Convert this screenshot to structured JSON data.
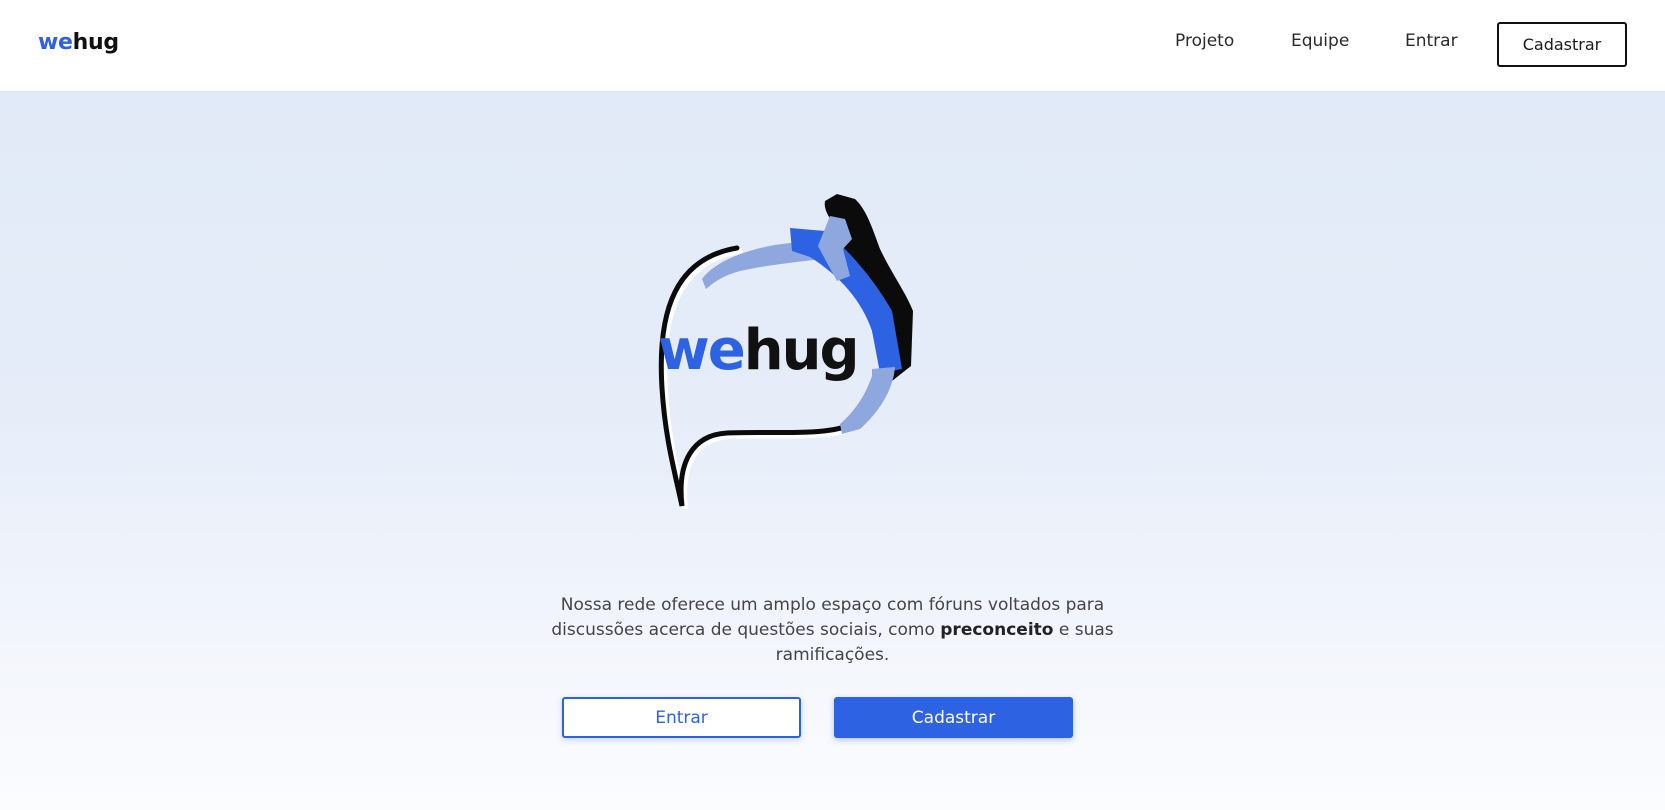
{
  "brand": {
    "we": "we",
    "hug": "hug"
  },
  "nav": {
    "links": [
      "Projeto",
      "Equipe",
      "Entrar"
    ],
    "cta": "Cadastrar"
  },
  "hero": {
    "logo": {
      "we": "we",
      "hug": "hug"
    },
    "description_before": "Nossa rede oferece um amplo espaço com fóruns voltados para discussões acerca de questões sociais, como ",
    "description_bold": "preconceito",
    "description_after": " e suas ramificações.",
    "buttons": {
      "login": "Entrar",
      "signup": "Cadastrar"
    }
  },
  "colors": {
    "accent": "#2d62e3",
    "accent_light": "#8ea8df",
    "dark": "#111111",
    "hero_bg_top": "#e1eaf8",
    "hero_bg_bottom": "#fbfcfe"
  }
}
